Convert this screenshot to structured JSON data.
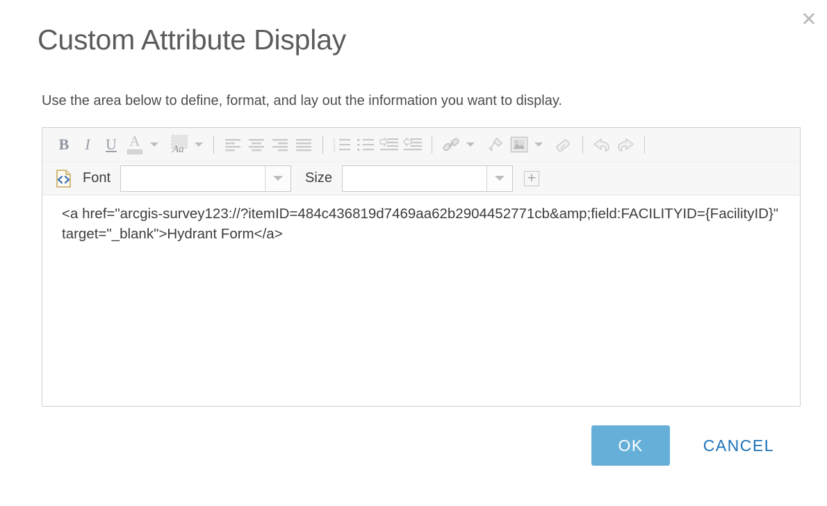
{
  "dialog": {
    "title": "Custom Attribute Display",
    "subtitle": "Use the area below to define, format, and lay out the information you want to display.",
    "close_label": "✕"
  },
  "toolbar": {
    "bold": "B",
    "italic": "I",
    "underline": "U",
    "font_color": "A",
    "highlight_color": "Aa",
    "align_left": "align-left",
    "align_center": "align-center",
    "align_right": "align-right",
    "align_justify": "align-justify",
    "numbered_list": "numbered-list",
    "bulleted_list": "bulleted-list",
    "indent": "indent",
    "outdent": "outdent",
    "link": "link",
    "anchor": "anchor",
    "image": "image",
    "eraser": "remove-format",
    "undo": "undo",
    "redo": "redo",
    "source_code": "source-code",
    "font_label": "Font",
    "font_value": "",
    "size_label": "Size",
    "size_value": "",
    "maximize": "+"
  },
  "editor": {
    "content": "<a href=\"arcgis-survey123://?itemID=484c436819d7469aa62b2904452771cb&amp;field:FACILITYID={FacilityID}\" target=\"_blank\">Hydrant Form</a>"
  },
  "footer": {
    "ok_label": "OK",
    "cancel_label": "CANCEL"
  },
  "colors": {
    "accent": "#66afd8",
    "link": "#1a70b8",
    "title_text": "#5b5b5b",
    "body_text": "#3c3c3c",
    "toolbar_bg": "#f7f7f7",
    "border": "#cfcfcf"
  }
}
